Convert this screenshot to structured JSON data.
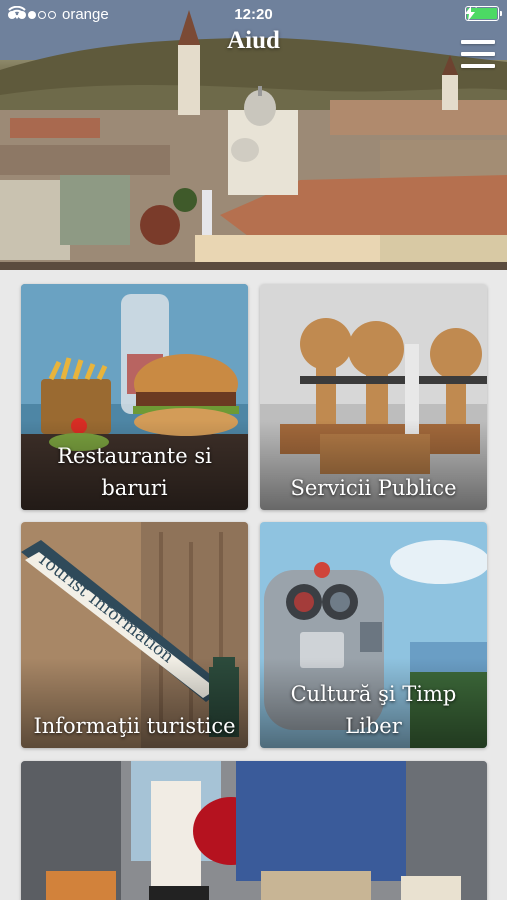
{
  "status_bar": {
    "carrier": "orange",
    "time": "12:20",
    "signal_bars": 3,
    "signal_total": 5,
    "battery_level": 1.0,
    "battery_color": "#4cd964"
  },
  "header": {
    "title": "Aiud",
    "menu_icon": "hamburger-icon"
  },
  "tiles": [
    {
      "label": "Restaurante si baruri",
      "image": "burger-fries-photo"
    },
    {
      "label": "Servicii Publice",
      "image": "rubber-stamps-photo"
    },
    {
      "label": "Informaţii turistice",
      "image": "tourist-information-sign-photo"
    },
    {
      "label": "Cultură şi Timp Liber",
      "image": "coin-binoculars-photo"
    },
    {
      "label": "",
      "image": "shopping-couple-photo"
    }
  ]
}
